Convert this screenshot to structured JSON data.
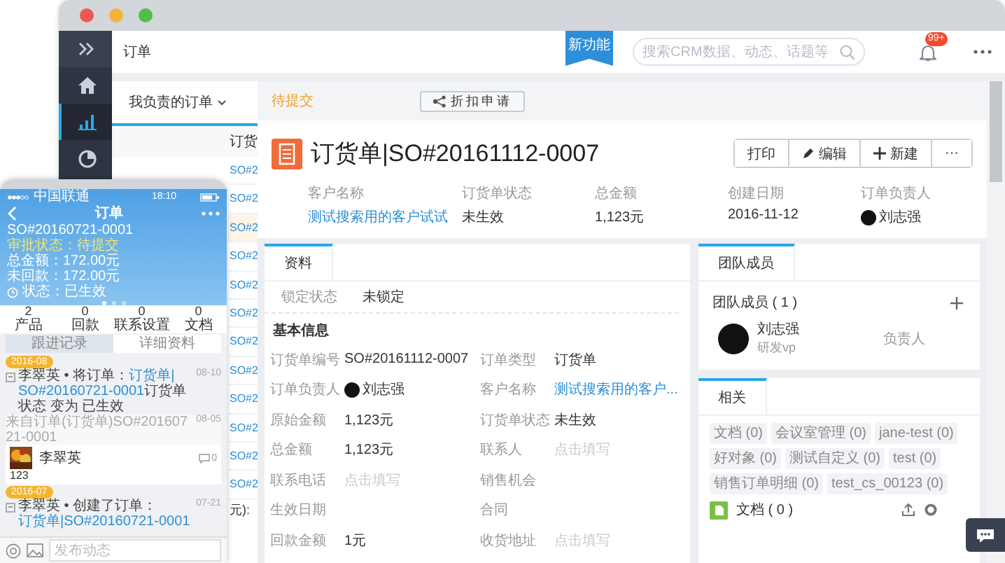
{
  "desktop": {
    "sidebar": [
      {
        "kind": "expand",
        "selected": false
      },
      {
        "kind": "home",
        "selected": false
      },
      {
        "kind": "chart",
        "selected": true
      },
      {
        "kind": "pie",
        "selected": false
      }
    ],
    "header": {
      "title": "订单",
      "ribbon": "新功能",
      "search": {
        "placeholder": "搜索CRM数据、动态、话题等"
      },
      "badge": "99+"
    },
    "list": {
      "filter": "我负责的订单",
      "column": "订货",
      "rows": [
        {
          "text": "SO#2",
          "selected": false
        },
        {
          "text": "SO#2",
          "selected": false
        },
        {
          "text": "SO#2",
          "selected": true
        },
        {
          "text": "SO#2",
          "selected": false
        },
        {
          "text": "SO#2",
          "selected": false
        },
        {
          "text": "SO#2",
          "selected": false
        },
        {
          "text": "SO#2",
          "selected": false
        },
        {
          "text": "SO#2",
          "selected": false
        },
        {
          "text": "SO#2",
          "selected": false
        },
        {
          "text": "SO#2",
          "selected": false
        },
        {
          "text": "SO#2",
          "selected": false
        },
        {
          "text": "SO#2",
          "selected": false
        }
      ],
      "footer": "元):"
    },
    "detail": {
      "status": "待提交",
      "discount_button": "折扣申请",
      "title": "订货单|SO#20161112-0007",
      "actions": [
        {
          "label": "打印",
          "kind": "text"
        },
        {
          "label": "编辑",
          "kind": "edit"
        },
        {
          "label": "新建",
          "kind": "add"
        },
        {
          "label": "···",
          "kind": "text"
        }
      ],
      "summary": [
        {
          "label": "客户名称",
          "value": "测试搜索用的客户试试",
          "kind": "link"
        },
        {
          "label": "订货单状态",
          "value": "未生效",
          "kind": "text"
        },
        {
          "label": "总金额",
          "value": "1,123元",
          "kind": "text"
        },
        {
          "label": "创建日期",
          "value": "2016-11-12",
          "kind": "text"
        },
        {
          "label": "订单负责人",
          "value": "刘志强",
          "kind": "person"
        }
      ],
      "info_tab": "资料",
      "lock": {
        "label": "锁定状态",
        "value": "未锁定"
      },
      "section": "基本信息",
      "fields": [
        {
          "label": "订货单编号",
          "value": "SO#20161112-0007",
          "kind": "text"
        },
        {
          "label": "订单类型",
          "value": "订货单",
          "kind": "text"
        },
        {
          "label": "订单负责人",
          "value": "刘志强",
          "kind": "person"
        },
        {
          "label": "客户名称",
          "value": "测试搜索用的客户...",
          "kind": "link"
        },
        {
          "label": "原始金额",
          "value": "1,123元",
          "kind": "text"
        },
        {
          "label": "订货单状态",
          "value": "未生效",
          "kind": "text"
        },
        {
          "label": "总金额",
          "value": "1,123元",
          "kind": "text"
        },
        {
          "label": "联系人",
          "placeholder": "点击填写",
          "kind": "placeholder"
        },
        {
          "label": "联系电话",
          "placeholder": "点击填写",
          "kind": "placeholder"
        },
        {
          "label": "销售机会",
          "kind": "empty"
        },
        {
          "label": "生效日期",
          "kind": "empty"
        },
        {
          "label": "合同",
          "kind": "empty"
        },
        {
          "label": "回款金额",
          "value": "1元",
          "kind": "text"
        },
        {
          "label": "收货地址",
          "placeholder": "点击填写",
          "kind": "placeholder"
        }
      ],
      "team": {
        "tab": "团队成员",
        "heading": "团队成员 ( 1 )",
        "members": [
          {
            "name": "刘志强",
            "title": "研发vp",
            "role": "负责人"
          }
        ]
      },
      "related": {
        "tab": "相关",
        "tags": [
          "文档 (0)",
          "会议室管理 (0)",
          "jane-test (0)",
          "好对象 (0)",
          "测试自定义 (0)",
          "test (0)",
          "销售订单明细 (0)",
          "test_cs_00123 (0)"
        ],
        "docs": "文档 ( 0 )"
      }
    }
  },
  "phone": {
    "carrier": "中国联通",
    "time": "18:10",
    "title": "订单",
    "order_no": "SO#20160721-0001",
    "approval": "审批状态：待提交",
    "total": "总金额：172.00元",
    "unpaid": "未回款：172.00元",
    "state": "状态：已生效",
    "pages": [
      {
        "selected": true
      },
      {
        "selected": false
      },
      {
        "selected": false
      }
    ],
    "stats": [
      {
        "value": "2",
        "label": "产品"
      },
      {
        "value": "0",
        "label": "回款"
      },
      {
        "value": "0",
        "label": "联系设置"
      },
      {
        "value": "0",
        "label": "文档"
      }
    ],
    "tabs": [
      {
        "label": "跟进记录",
        "selected": true
      },
      {
        "label": "详细资料",
        "selected": false
      }
    ],
    "feed": [
      {
        "kind": "month",
        "text": "2016-08"
      },
      {
        "kind": "event",
        "actor": "李翠英 • 将订单：",
        "links": [
          "订货单|",
          "SO#20160721-0001"
        ],
        "rest": "订货单状态 变为 已生效",
        "time": "08-10"
      },
      {
        "kind": "source",
        "text": "来自订单(订货单)SO#20160721-0001",
        "time": "08-05"
      },
      {
        "kind": "post",
        "author": "李翠英",
        "comments": "0",
        "body": "123"
      },
      {
        "kind": "month",
        "text": "2016-07"
      },
      {
        "kind": "event",
        "actor": "李翠英 • 创建了订单：",
        "links": [
          "订货单|",
          "SO#20160721-0001"
        ],
        "time": "07-21"
      }
    ],
    "composer": {
      "placeholder": "发布动态"
    }
  }
}
